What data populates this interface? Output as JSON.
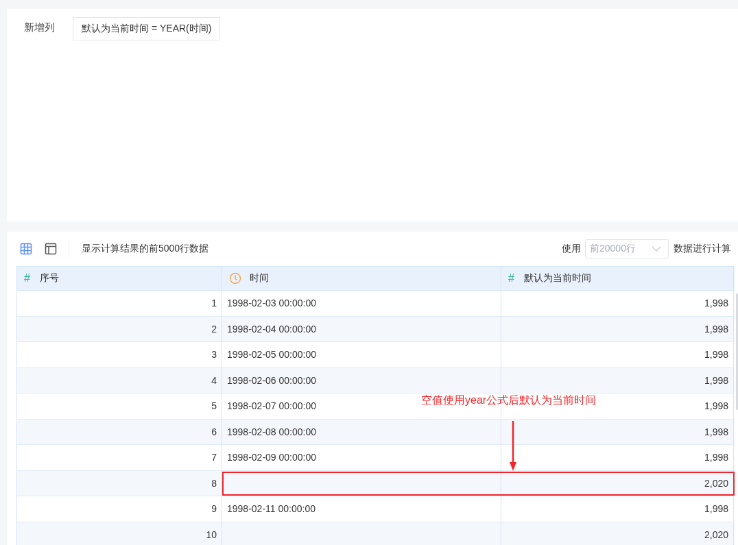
{
  "formula_panel": {
    "label": "新增列",
    "formula": "默认为当前时间 = YEAR(时间)"
  },
  "toolbar": {
    "info": "显示计算结果的前5000行数据",
    "use_label": "使用",
    "row_limit": {
      "value": "前20000行",
      "disabled": true
    },
    "suffix": "数据进行计算"
  },
  "table": {
    "columns": [
      {
        "label": "序号",
        "kind": "number",
        "icon": "#"
      },
      {
        "label": "时间",
        "kind": "time"
      },
      {
        "label": "默认为当前时间",
        "kind": "number",
        "icon": "#"
      }
    ],
    "rows": [
      {
        "index": "1",
        "time": "1998-02-03 00:00:00",
        "value": "1,998",
        "highlighted": false
      },
      {
        "index": "2",
        "time": "1998-02-04 00:00:00",
        "value": "1,998",
        "highlighted": false
      },
      {
        "index": "3",
        "time": "1998-02-05 00:00:00",
        "value": "1,998",
        "highlighted": false
      },
      {
        "index": "4",
        "time": "1998-02-06 00:00:00",
        "value": "1,998",
        "highlighted": false
      },
      {
        "index": "5",
        "time": "1998-02-07 00:00:00",
        "value": "1,998",
        "highlighted": false
      },
      {
        "index": "6",
        "time": "1998-02-08 00:00:00",
        "value": "1,998",
        "highlighted": false
      },
      {
        "index": "7",
        "time": "1998-02-09 00:00:00",
        "value": "1,998",
        "highlighted": false
      },
      {
        "index": "8",
        "value": "2,020",
        "highlighted": true
      },
      {
        "index": "9",
        "time": "1998-02-11 00:00:00",
        "value": "1,998",
        "highlighted": false
      },
      {
        "index": "10",
        "value": "2,020",
        "highlighted": false
      }
    ]
  },
  "annotation": {
    "text": "空值使用year公式后默认为当前时间"
  }
}
